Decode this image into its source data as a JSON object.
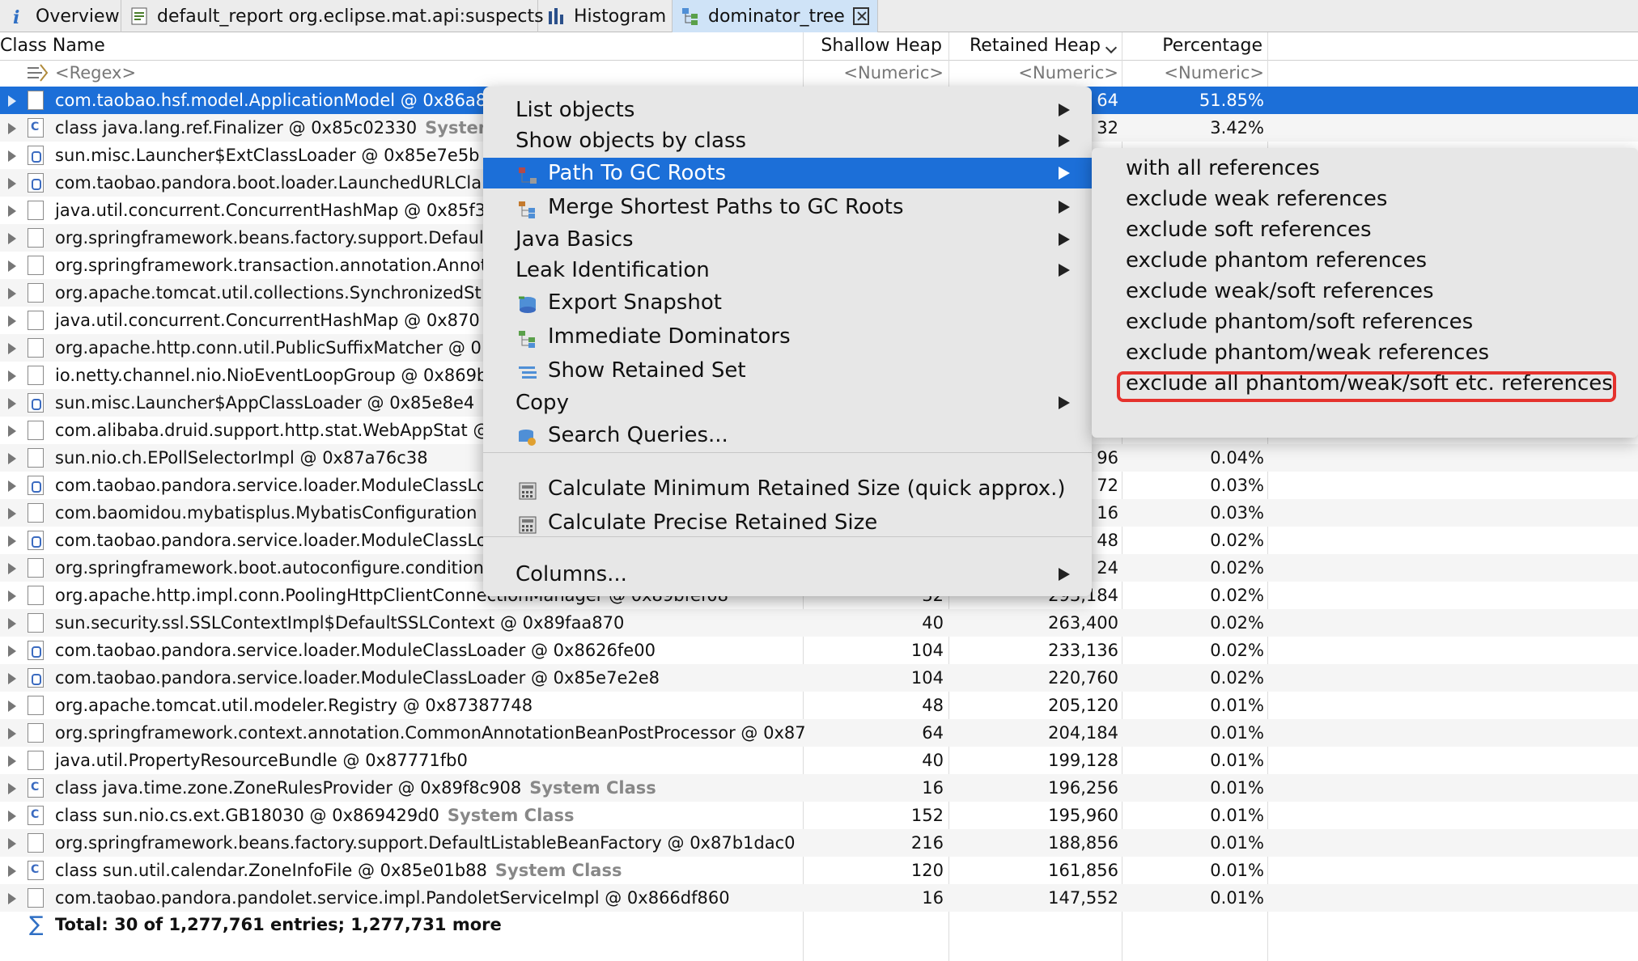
{
  "tabs": [
    {
      "label": "Overview",
      "icon": "info-icon"
    },
    {
      "label": "default_report  org.eclipse.mat.api:suspects",
      "icon": "report-icon"
    },
    {
      "label": "Histogram",
      "icon": "histogram-icon"
    },
    {
      "label": "dominator_tree",
      "icon": "dominator-tree-icon",
      "close_icon": "close-icon"
    }
  ],
  "columns": {
    "class_name": "Class Name",
    "shallow_heap": "Shallow Heap",
    "retained_heap": "Retained Heap",
    "percentage": "Percentage"
  },
  "filters": {
    "class_name": "<Regex>",
    "shallow_heap": "<Numeric>",
    "retained_heap": "<Numeric>",
    "percentage": "<Numeric>"
  },
  "rows": [
    {
      "name": "com.taobao.hsf.model.ApplicationModel @ 0x86a8",
      "sys": "",
      "shallow": "",
      "retained": "64",
      "pct": "51.85%",
      "icon": "object-icon"
    },
    {
      "name": "class java.lang.ref.Finalizer @ 0x85c02330",
      "sys": "System",
      "shallow": "",
      "retained": "32",
      "pct": "3.42%",
      "icon": "class-icon"
    },
    {
      "name": "sun.misc.Launcher$ExtClassLoader @ 0x85e7e5b",
      "sys": "",
      "shallow": "",
      "retained": "",
      "pct": "",
      "icon": "classloader-icon"
    },
    {
      "name": "com.taobao.pandora.boot.loader.LaunchedURLCla",
      "sys": "",
      "shallow": "",
      "retained": "",
      "pct": "",
      "icon": "classloader-icon"
    },
    {
      "name": "java.util.concurrent.ConcurrentHashMap @ 0x85f3",
      "sys": "",
      "shallow": "",
      "retained": "",
      "pct": "",
      "icon": "object-icon"
    },
    {
      "name": "org.springframework.beans.factory.support.Defaul",
      "sys": "",
      "shallow": "",
      "retained": "",
      "pct": "",
      "icon": "object-icon"
    },
    {
      "name": "org.springframework.transaction.annotation.Annot",
      "sys": "",
      "shallow": "",
      "retained": "",
      "pct": "",
      "icon": "object-icon"
    },
    {
      "name": "org.apache.tomcat.util.collections.SynchronizedSt",
      "sys": "",
      "shallow": "",
      "retained": "",
      "pct": "",
      "icon": "object-icon"
    },
    {
      "name": "java.util.concurrent.ConcurrentHashMap @ 0x870",
      "sys": "",
      "shallow": "",
      "retained": "",
      "pct": "",
      "icon": "object-icon"
    },
    {
      "name": "org.apache.http.conn.util.PublicSuffixMatcher @ 0",
      "sys": "",
      "shallow": "",
      "retained": "",
      "pct": "",
      "icon": "object-icon"
    },
    {
      "name": "io.netty.channel.nio.NioEventLoopGroup @ 0x869b",
      "sys": "",
      "shallow": "",
      "retained": "",
      "pct": "",
      "icon": "object-icon"
    },
    {
      "name": "sun.misc.Launcher$AppClassLoader @ 0x85e8e4",
      "sys": "",
      "shallow": "",
      "retained": "",
      "pct": "",
      "icon": "classloader-icon"
    },
    {
      "name": "com.alibaba.druid.support.http.stat.WebAppStat @",
      "sys": "",
      "shallow": "",
      "retained": "",
      "pct": "",
      "icon": "object-icon"
    },
    {
      "name": "sun.nio.ch.EPollSelectorImpl @ 0x87a76c38",
      "sys": "",
      "shallow": "",
      "retained": "96",
      "pct": "0.04%",
      "icon": "object-icon"
    },
    {
      "name": "com.taobao.pandora.service.loader.ModuleClassLo",
      "sys": "",
      "shallow": "",
      "retained": "72",
      "pct": "0.03%",
      "icon": "classloader-icon"
    },
    {
      "name": "com.baomidou.mybatisplus.MybatisConfiguration @",
      "sys": "",
      "shallow": "",
      "retained": "16",
      "pct": "0.03%",
      "icon": "object-icon"
    },
    {
      "name": "com.taobao.pandora.service.loader.ModuleClassLo",
      "sys": "",
      "shallow": "",
      "retained": "48",
      "pct": "0.02%",
      "icon": "classloader-icon"
    },
    {
      "name": "org.springframework.boot.autoconfigure.condition",
      "sys": "",
      "shallow": "",
      "retained": "24",
      "pct": "0.02%",
      "icon": "object-icon"
    },
    {
      "name": "org.apache.http.impl.conn.PoolingHttpClientConnectionManager @ 0x89bfef08",
      "sys": "",
      "shallow": "32",
      "retained": "293,184",
      "pct": "0.02%",
      "icon": "object-icon"
    },
    {
      "name": "sun.security.ssl.SSLContextImpl$DefaultSSLContext @ 0x89faa870",
      "sys": "",
      "shallow": "40",
      "retained": "263,400",
      "pct": "0.02%",
      "icon": "object-icon"
    },
    {
      "name": "com.taobao.pandora.service.loader.ModuleClassLoader @ 0x8626fe00",
      "sys": "",
      "shallow": "104",
      "retained": "233,136",
      "pct": "0.02%",
      "icon": "classloader-icon"
    },
    {
      "name": "com.taobao.pandora.service.loader.ModuleClassLoader @ 0x85e7e2e8",
      "sys": "",
      "shallow": "104",
      "retained": "220,760",
      "pct": "0.02%",
      "icon": "classloader-icon"
    },
    {
      "name": "org.apache.tomcat.util.modeler.Registry @ 0x87387748",
      "sys": "",
      "shallow": "48",
      "retained": "205,120",
      "pct": "0.01%",
      "icon": "object-icon"
    },
    {
      "name": "org.springframework.context.annotation.CommonAnnotationBeanPostProcessor @ 0x87",
      "sys": "",
      "shallow": "64",
      "retained": "204,184",
      "pct": "0.01%",
      "icon": "object-icon"
    },
    {
      "name": "java.util.PropertyResourceBundle @ 0x87771fb0",
      "sys": "",
      "shallow": "40",
      "retained": "199,128",
      "pct": "0.01%",
      "icon": "object-icon"
    },
    {
      "name": "class java.time.zone.ZoneRulesProvider @ 0x89f8c908",
      "sys": "System Class",
      "shallow": "16",
      "retained": "196,256",
      "pct": "0.01%",
      "icon": "class-icon"
    },
    {
      "name": "class sun.nio.cs.ext.GB18030 @ 0x869429d0",
      "sys": "System Class",
      "shallow": "152",
      "retained": "195,960",
      "pct": "0.01%",
      "icon": "class-icon"
    },
    {
      "name": "org.springframework.beans.factory.support.DefaultListableBeanFactory @ 0x87b1dac0",
      "sys": "",
      "shallow": "216",
      "retained": "188,856",
      "pct": "0.01%",
      "icon": "object-icon"
    },
    {
      "name": "class sun.util.calendar.ZoneInfoFile @ 0x85e01b88",
      "sys": "System Class",
      "shallow": "120",
      "retained": "161,856",
      "pct": "0.01%",
      "icon": "class-icon"
    },
    {
      "name": "com.taobao.pandora.pandolet.service.impl.PandoletServiceImpl @ 0x866df860",
      "sys": "",
      "shallow": "16",
      "retained": "147,552",
      "pct": "0.01%",
      "icon": "object-icon"
    }
  ],
  "total": "Total: 30 of 1,277,761 entries; 1,277,731 more",
  "context_menu": [
    {
      "label": "List objects",
      "submenu": true,
      "icon": ""
    },
    {
      "label": "Show objects by class",
      "submenu": true,
      "icon": ""
    },
    {
      "label": "Path To GC Roots",
      "submenu": true,
      "icon": "path-icon",
      "highlighted": true
    },
    {
      "label": "Merge Shortest Paths to GC Roots",
      "submenu": true,
      "icon": "merge-paths-icon"
    },
    {
      "label": "Java Basics",
      "submenu": true,
      "icon": ""
    },
    {
      "label": "Leak Identification",
      "submenu": true,
      "icon": ""
    },
    {
      "label": "Export Snapshot",
      "submenu": false,
      "icon": "export-icon"
    },
    {
      "label": "Immediate Dominators",
      "submenu": false,
      "icon": "dominators-icon"
    },
    {
      "label": "Show Retained Set",
      "submenu": false,
      "icon": "retained-set-icon"
    },
    {
      "label": "Copy",
      "submenu": true,
      "icon": ""
    },
    {
      "label": "Search Queries...",
      "submenu": false,
      "icon": "search-queries-icon"
    },
    {
      "label": "Calculate Minimum Retained Size (quick approx.)",
      "submenu": false,
      "icon": "calculator-icon"
    },
    {
      "label": "Calculate Precise Retained Size",
      "submenu": false,
      "icon": "calculator-icon"
    },
    {
      "label": "Columns...",
      "submenu": true,
      "icon": ""
    }
  ],
  "submenu": [
    "with all references",
    "exclude weak references",
    "exclude soft references",
    "exclude phantom references",
    "exclude weak/soft references",
    "exclude phantom/soft references",
    "exclude phantom/weak references",
    "exclude all phantom/weak/soft etc. references"
  ],
  "highlighted_submenu_index": 7,
  "colors": {
    "selection": "#1c6fd8",
    "annotation": "#e5322d",
    "active_tab": "#cfe3f7"
  }
}
